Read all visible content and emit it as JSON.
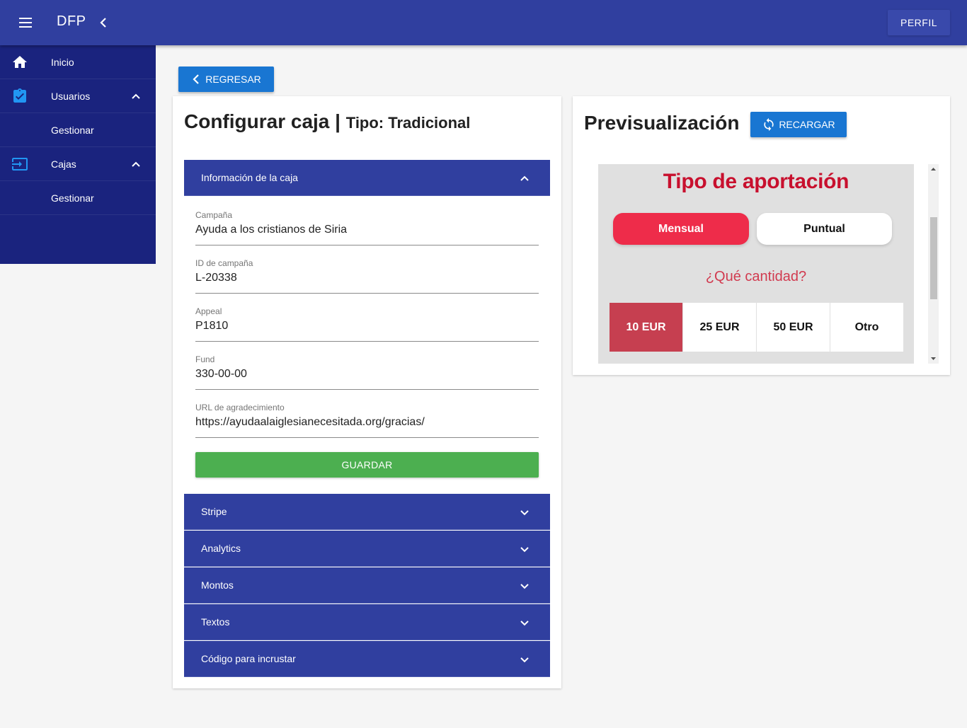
{
  "app": {
    "title": "DFP",
    "profile_label": "PERFIL"
  },
  "sidebar": {
    "items": [
      {
        "label": "Inicio",
        "icon": "home-icon"
      },
      {
        "label": "Usuarios",
        "icon": "clipboard-check-icon"
      },
      {
        "label": "Gestionar"
      },
      {
        "label": "Cajas",
        "icon": "input-icon"
      },
      {
        "label": "Gestionar"
      }
    ]
  },
  "back_label": "REGRESAR",
  "config": {
    "title": "Configurar caja |",
    "type_label": "Tipo: Tradicional",
    "sections": {
      "info": "Información de la caja",
      "stripe": "Stripe",
      "analytics": "Analytics",
      "amounts": "Montos",
      "texts": "Textos",
      "embed": "Código para incrustar"
    },
    "fields": {
      "campaign": {
        "label": "Campaña",
        "value": "Ayuda a los cristianos de Siria"
      },
      "campaign_id": {
        "label": "ID de campaña",
        "value": "L-20338"
      },
      "appeal": {
        "label": "Appeal",
        "value": "P1810"
      },
      "fund": {
        "label": "Fund",
        "value": "330-00-00"
      },
      "thanks_url": {
        "label": "URL de agradecimiento",
        "value": "https://ayudaalaiglesianecesitada.org/gracias/"
      }
    },
    "save_label": "GUARDAR"
  },
  "preview": {
    "title": "Previsualización",
    "reload_label": "RECARGAR",
    "heading": "Tipo de aportación",
    "monthly_label": "Mensual",
    "once_label": "Puntual",
    "question": "¿Qué cantidad?",
    "amounts": [
      "10 EUR",
      "25 EUR",
      "50 EUR",
      "Otro"
    ],
    "selected_amount": "10 EUR"
  },
  "colors": {
    "app_bar": "#303f9f",
    "sidebar": "#1a237e",
    "primary_button": "#1976d2",
    "save_button": "#4caf50",
    "preview_red": "#c8102e",
    "toggle_active": "#ee2c4a",
    "amount_selected": "#c63f50"
  }
}
